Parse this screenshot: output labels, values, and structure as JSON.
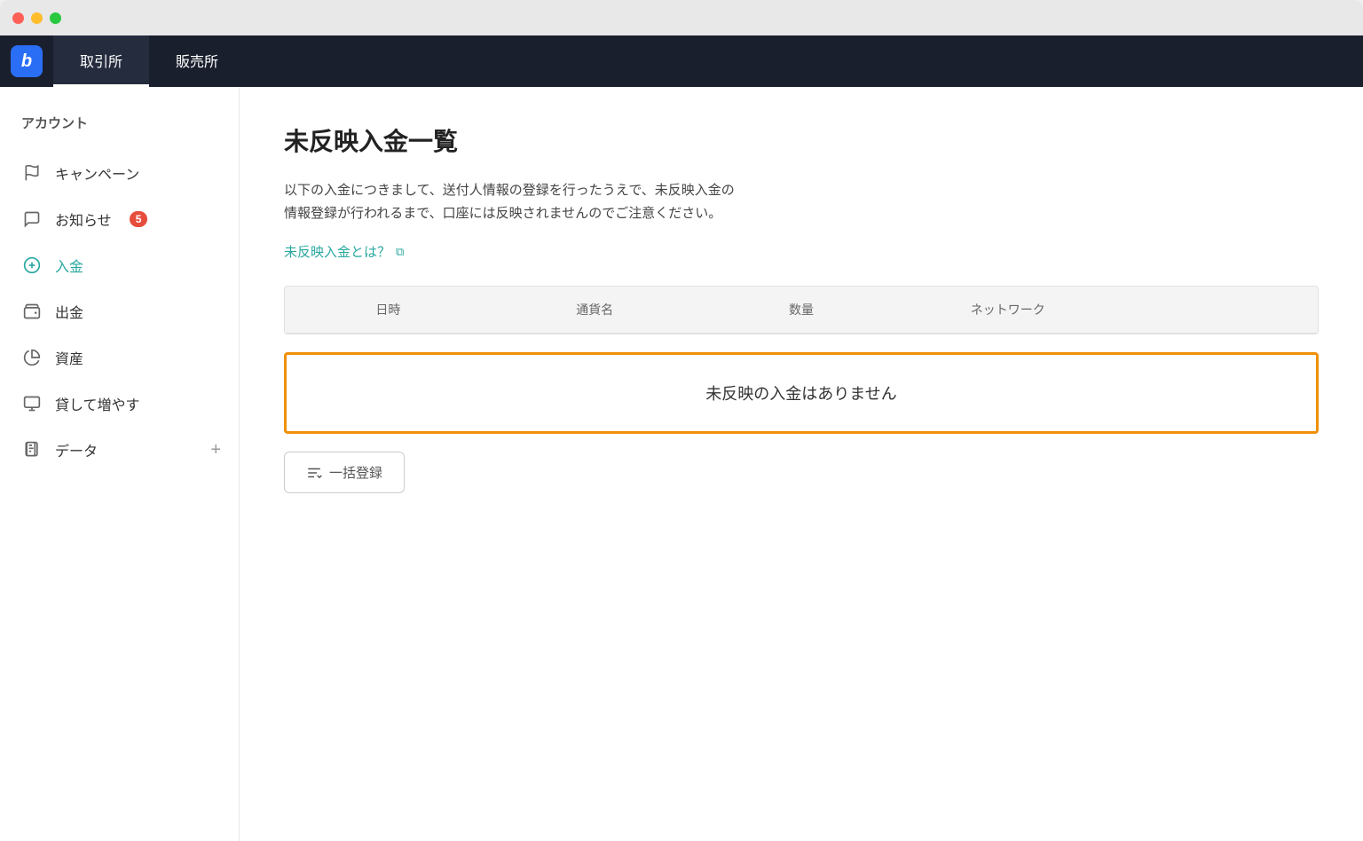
{
  "window": {
    "traffic_lights": [
      "red",
      "yellow",
      "green"
    ]
  },
  "nav": {
    "logo_text": "b",
    "tabs": [
      {
        "id": "exchange",
        "label": "取引所",
        "active": true
      },
      {
        "id": "shop",
        "label": "販売所",
        "active": false
      }
    ]
  },
  "sidebar": {
    "section_title": "アカウント",
    "items": [
      {
        "id": "campaign",
        "label": "キャンペーン",
        "icon": "flag",
        "badge": null,
        "plus": false
      },
      {
        "id": "news",
        "label": "お知らせ",
        "icon": "message",
        "badge": "5",
        "plus": false
      },
      {
        "id": "deposit",
        "label": "入金",
        "icon": "plus-circle",
        "badge": null,
        "plus": false,
        "active": true
      },
      {
        "id": "withdraw",
        "label": "出金",
        "icon": "wallet",
        "badge": null,
        "plus": false
      },
      {
        "id": "assets",
        "label": "資産",
        "icon": "pie-chart",
        "badge": null,
        "plus": false
      },
      {
        "id": "lend",
        "label": "貸して増やす",
        "icon": "monitor",
        "badge": null,
        "plus": false
      },
      {
        "id": "data",
        "label": "データ",
        "icon": "file",
        "badge": null,
        "plus": true
      }
    ]
  },
  "content": {
    "page_title": "未反映入金一覧",
    "description": "以下の入金につきまして、送付人情報の登録を行ったうえで、未反映入金の\n情報登録が行われるまで、口座には反映されませんのでご注意ください。",
    "info_link_text": "未反映入金とは？",
    "table": {
      "columns": [
        "日時",
        "通貨名",
        "数量",
        "ネットワーク"
      ],
      "empty_message": "未反映の入金はありません"
    },
    "batch_button_label": "一括登録"
  }
}
